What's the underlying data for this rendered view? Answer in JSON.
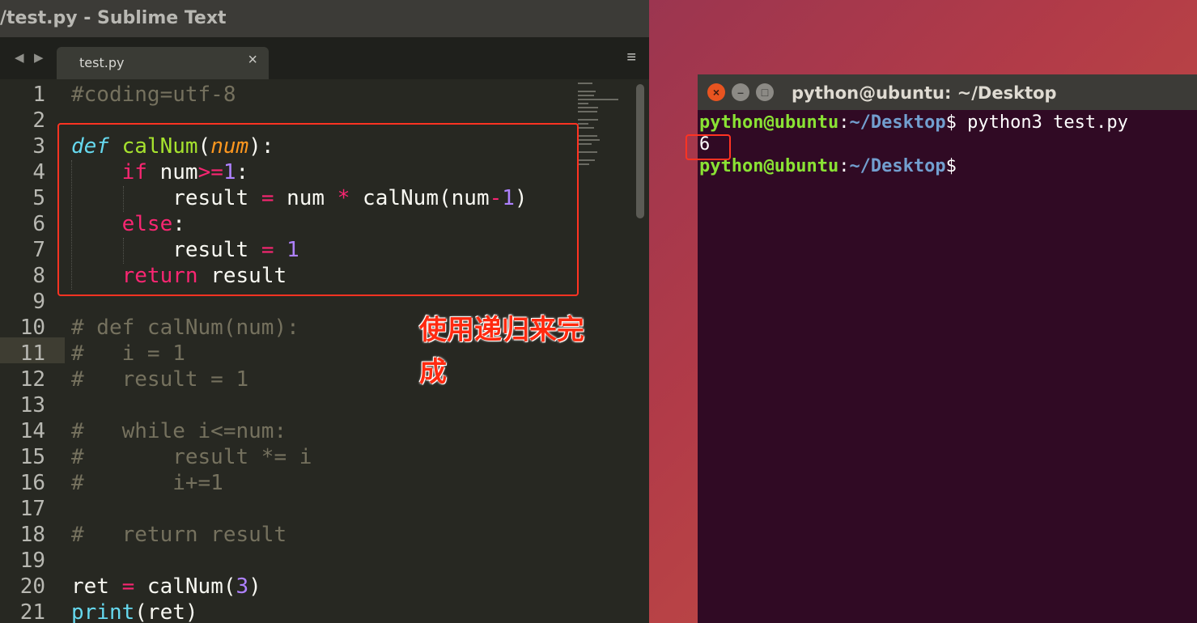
{
  "sublime": {
    "title": "/test.py - Sublime Text",
    "tab_label": "test.py",
    "tab_close": "×",
    "nav_back": "◀",
    "nav_forward": "▶",
    "menu_icon": "≡"
  },
  "editor": {
    "line_numbers": [
      "1",
      "2",
      "3",
      "4",
      "5",
      "6",
      "7",
      "8",
      "9",
      "10",
      "11",
      "12",
      "13",
      "14",
      "15",
      "16",
      "17",
      "18",
      "19",
      "20",
      "21"
    ],
    "current_line": "11",
    "lines": [
      [
        {
          "t": "cm",
          "v": "#coding=utf-8"
        }
      ],
      [],
      [
        {
          "t": "df",
          "v": "def"
        },
        {
          "t": "",
          "v": " "
        },
        {
          "t": "fn",
          "v": "calNum"
        },
        {
          "t": "",
          "v": "("
        },
        {
          "t": "pa",
          "v": "num"
        },
        {
          "t": "",
          "v": "):"
        }
      ],
      [
        {
          "t": "",
          "v": "    "
        },
        {
          "t": "kw",
          "v": "if"
        },
        {
          "t": "",
          "v": " num"
        },
        {
          "t": "kw",
          "v": ">="
        },
        {
          "t": "nu",
          "v": "1"
        },
        {
          "t": "",
          "v": ":"
        }
      ],
      [
        {
          "t": "",
          "v": "        result "
        },
        {
          "t": "kw",
          "v": "="
        },
        {
          "t": "",
          "v": " num "
        },
        {
          "t": "kw",
          "v": "*"
        },
        {
          "t": "",
          "v": " calNum(num"
        },
        {
          "t": "kw",
          "v": "-"
        },
        {
          "t": "nu",
          "v": "1"
        },
        {
          "t": "",
          "v": ")"
        }
      ],
      [
        {
          "t": "",
          "v": "    "
        },
        {
          "t": "kw",
          "v": "else"
        },
        {
          "t": "",
          "v": ":"
        }
      ],
      [
        {
          "t": "",
          "v": "        result "
        },
        {
          "t": "kw",
          "v": "="
        },
        {
          "t": "",
          "v": " "
        },
        {
          "t": "nu",
          "v": "1"
        }
      ],
      [
        {
          "t": "",
          "v": "    "
        },
        {
          "t": "kw",
          "v": "return"
        },
        {
          "t": "",
          "v": " result"
        }
      ],
      [],
      [
        {
          "t": "cm",
          "v": "# def calNum(num):"
        }
      ],
      [
        {
          "t": "cm",
          "v": "#   i = 1"
        }
      ],
      [
        {
          "t": "cm",
          "v": "#   result = 1"
        }
      ],
      [],
      [
        {
          "t": "cm",
          "v": "#   while i<=num:"
        }
      ],
      [
        {
          "t": "cm",
          "v": "#       result *= i"
        }
      ],
      [
        {
          "t": "cm",
          "v": "#       i+=1"
        }
      ],
      [],
      [
        {
          "t": "cm",
          "v": "#   return result"
        }
      ],
      [],
      [
        {
          "t": "",
          "v": "ret "
        },
        {
          "t": "kw",
          "v": "="
        },
        {
          "t": "",
          "v": " calNum("
        },
        {
          "t": "nu",
          "v": "3"
        },
        {
          "t": "",
          "v": ")"
        }
      ],
      [
        {
          "t": "bi",
          "v": "print"
        },
        {
          "t": "",
          "v": "(ret)"
        }
      ]
    ]
  },
  "annotation": {
    "text": "使用递归来完成",
    "color": "#ff2a10"
  },
  "terminal": {
    "title": "python@ubuntu: ~/Desktop",
    "close_label": "×",
    "min_label": "–",
    "max_label": "□",
    "lines": [
      {
        "user": "python@ubuntu",
        "sep": ":",
        "path": "~/Desktop",
        "cmd": "$ python3 test.py"
      },
      {
        "output": "6"
      },
      {
        "user": "python@ubuntu",
        "sep": ":",
        "path": "~/Desktop",
        "cmd": "$"
      }
    ]
  },
  "colors": {
    "editor_bg": "#272822",
    "terminal_bg": "#300a24",
    "highlight_border": "#ff3322"
  }
}
